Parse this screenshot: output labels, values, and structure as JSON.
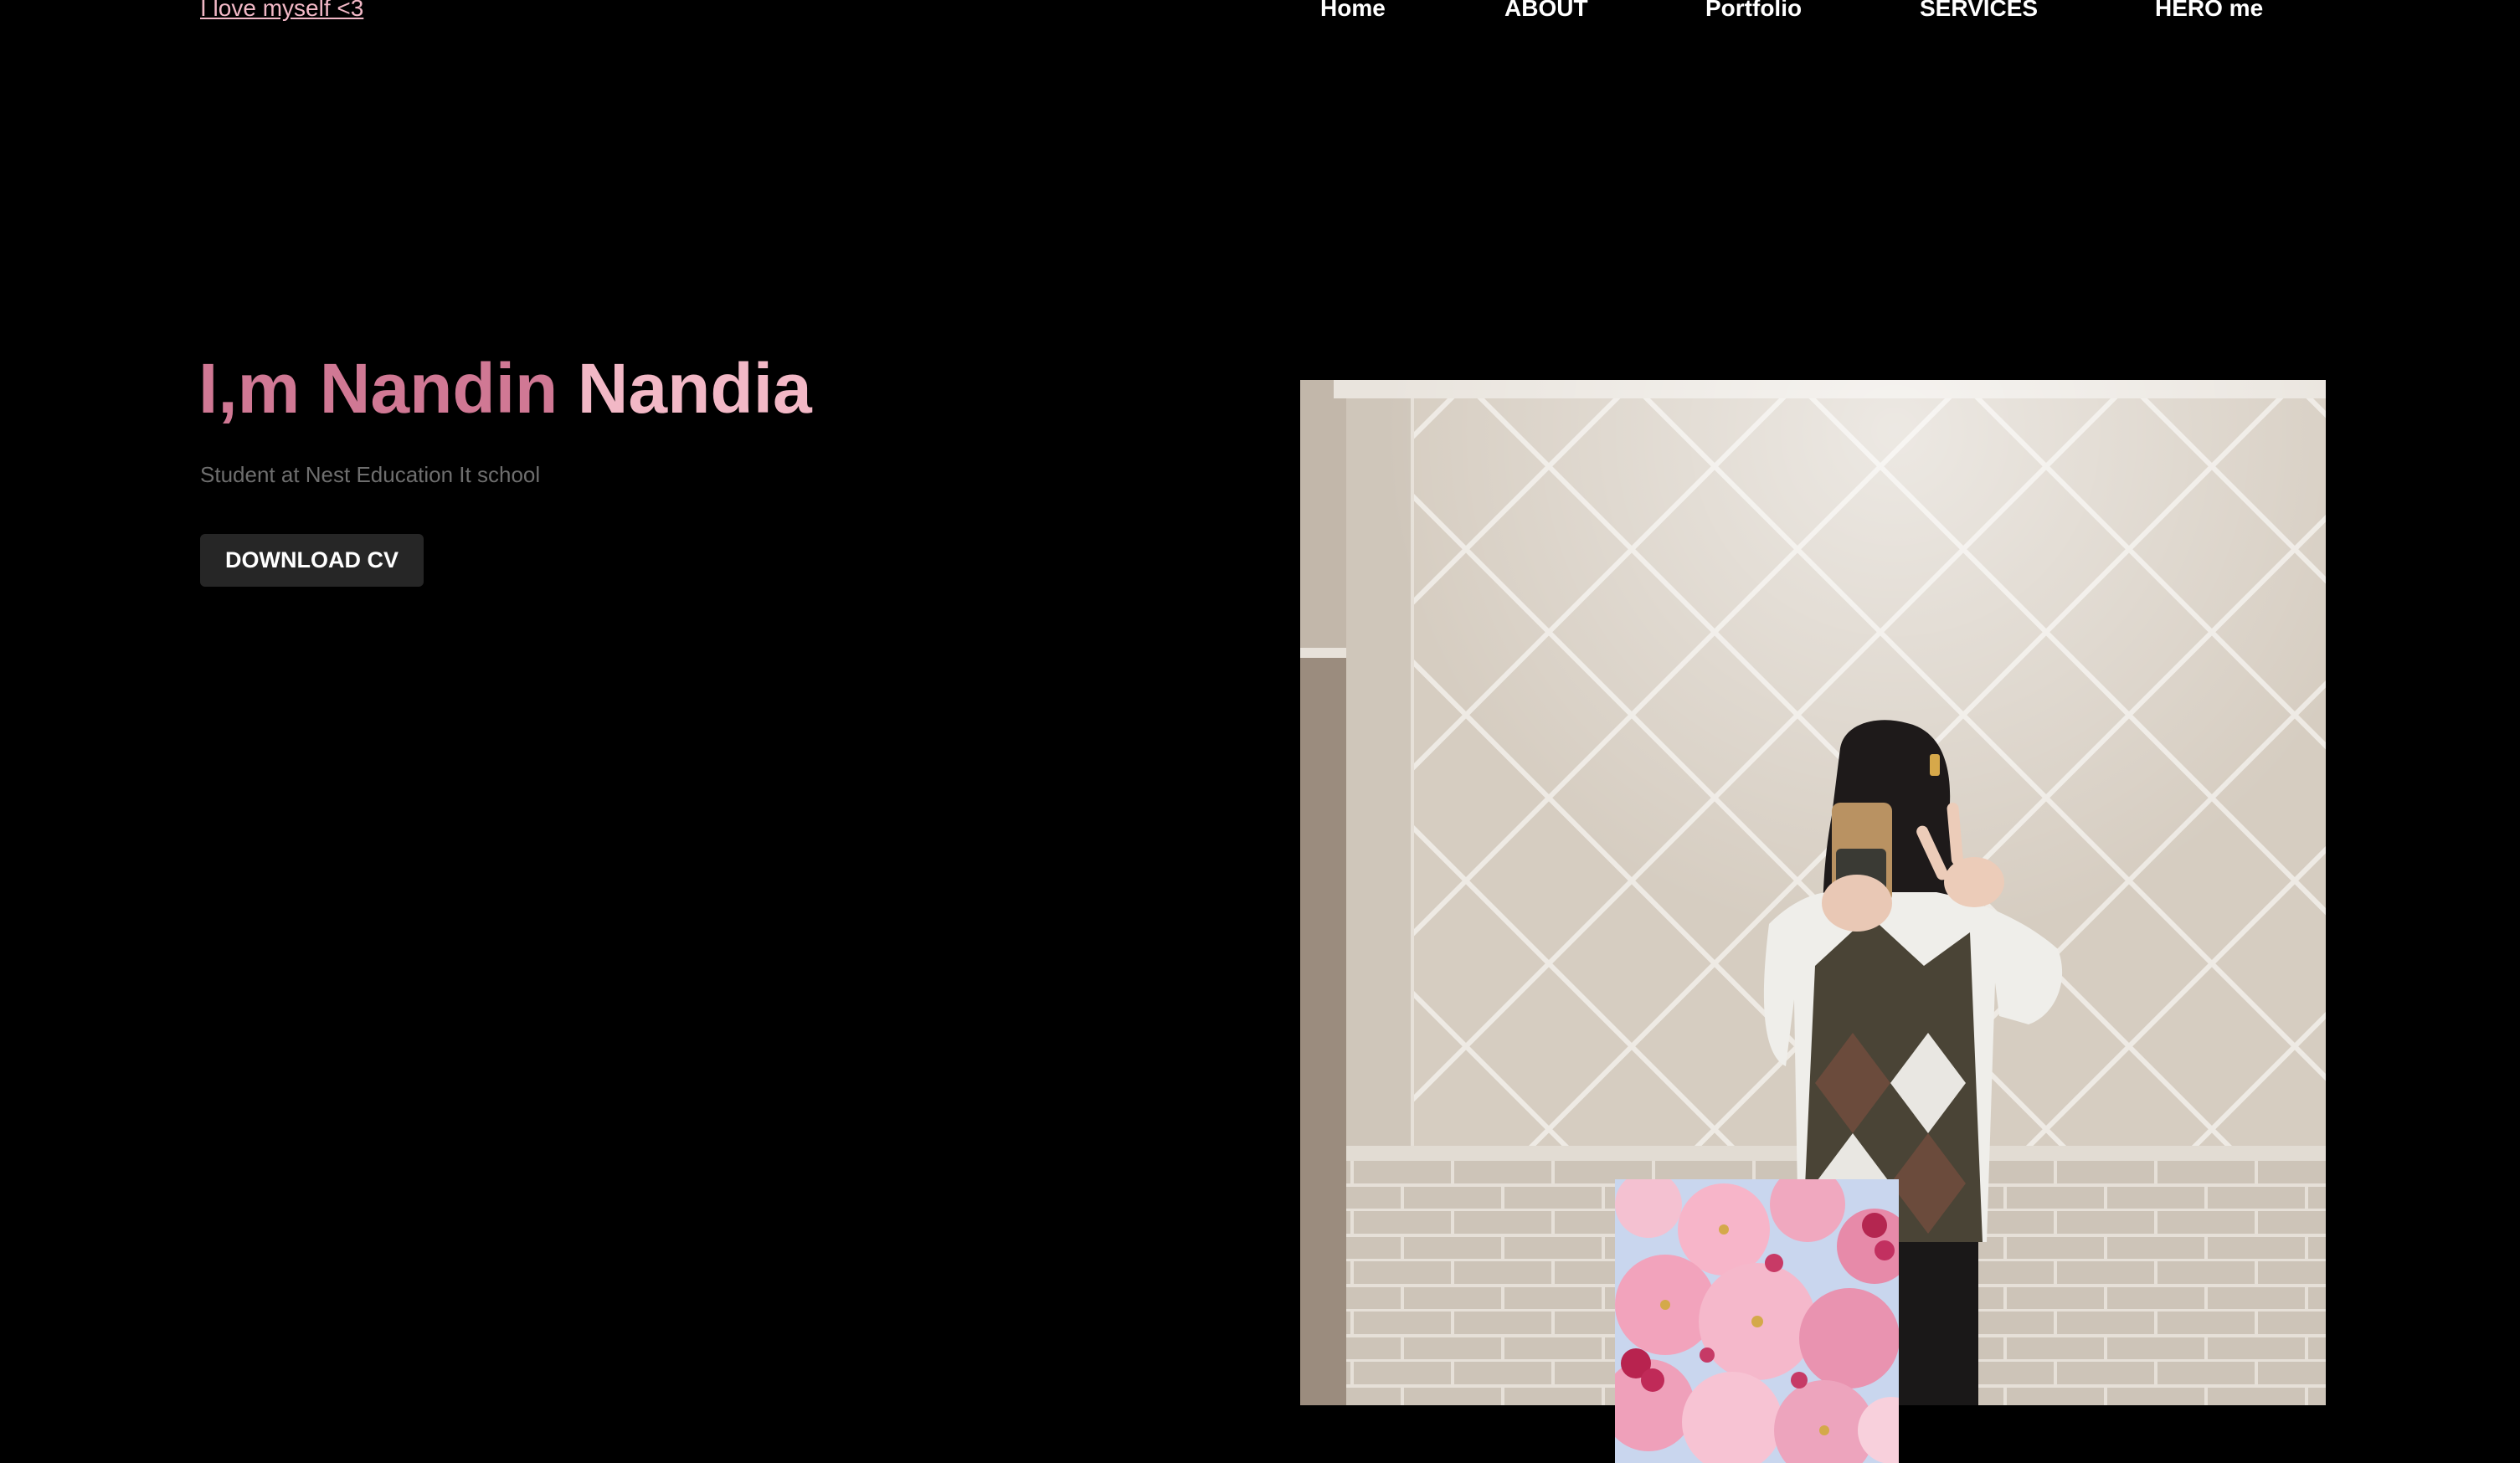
{
  "header": {
    "logo_text": "I love myself <3",
    "nav": [
      {
        "label": "Home"
      },
      {
        "label": "ABOUT"
      },
      {
        "label": "Portfolio"
      },
      {
        "label": "SERVICES"
      },
      {
        "label": "HERO me"
      }
    ]
  },
  "hero": {
    "title_part1": "I,m Nandin",
    "title_part2": "Nandia",
    "subtitle": "Student at Nest Education It school",
    "cta_label": "DOWNLOAD CV"
  },
  "colors": {
    "background": "#000000",
    "accent_pink": "#f2b8c6",
    "accent_rose": "#d07894",
    "button_bg": "#262626",
    "subtitle_gray": "#6e6e6e"
  }
}
